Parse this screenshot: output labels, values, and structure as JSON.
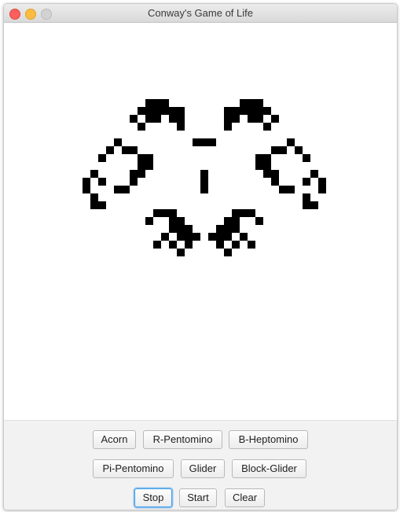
{
  "window": {
    "title": "Conway's Game of Life"
  },
  "grid": {
    "live_color": "#000000",
    "background_color": "#ffffff",
    "live_cells": [
      [
        185,
        126
      ],
      [
        195,
        126
      ],
      [
        205,
        126
      ],
      [
        305,
        126
      ],
      [
        315,
        126
      ],
      [
        325,
        126
      ],
      [
        175,
        136
      ],
      [
        185,
        136
      ],
      [
        195,
        136
      ],
      [
        205,
        136
      ],
      [
        215,
        136
      ],
      [
        225,
        136
      ],
      [
        285,
        136
      ],
      [
        295,
        136
      ],
      [
        305,
        136
      ],
      [
        315,
        136
      ],
      [
        325,
        136
      ],
      [
        335,
        136
      ],
      [
        165,
        146
      ],
      [
        185,
        146
      ],
      [
        195,
        146
      ],
      [
        215,
        146
      ],
      [
        225,
        146
      ],
      [
        285,
        146
      ],
      [
        295,
        146
      ],
      [
        315,
        146
      ],
      [
        325,
        146
      ],
      [
        345,
        146
      ],
      [
        175,
        156
      ],
      [
        225,
        156
      ],
      [
        285,
        156
      ],
      [
        335,
        156
      ],
      [
        245,
        176
      ],
      [
        255,
        176
      ],
      [
        265,
        176
      ],
      [
        145,
        176
      ],
      [
        365,
        176
      ],
      [
        135,
        186
      ],
      [
        155,
        186
      ],
      [
        165,
        186
      ],
      [
        345,
        186
      ],
      [
        355,
        186
      ],
      [
        375,
        186
      ],
      [
        125,
        196
      ],
      [
        175,
        196
      ],
      [
        185,
        196
      ],
      [
        325,
        196
      ],
      [
        335,
        196
      ],
      [
        385,
        196
      ],
      [
        175,
        206
      ],
      [
        185,
        206
      ],
      [
        325,
        206
      ],
      [
        335,
        206
      ],
      [
        115,
        216
      ],
      [
        165,
        216
      ],
      [
        175,
        216
      ],
      [
        255,
        216
      ],
      [
        335,
        216
      ],
      [
        345,
        216
      ],
      [
        395,
        216
      ],
      [
        105,
        226
      ],
      [
        125,
        226
      ],
      [
        165,
        226
      ],
      [
        255,
        226
      ],
      [
        345,
        226
      ],
      [
        385,
        226
      ],
      [
        405,
        226
      ],
      [
        105,
        236
      ],
      [
        145,
        236
      ],
      [
        155,
        236
      ],
      [
        255,
        236
      ],
      [
        355,
        236
      ],
      [
        365,
        236
      ],
      [
        405,
        236
      ],
      [
        115,
        246
      ],
      [
        385,
        246
      ],
      [
        115,
        256
      ],
      [
        125,
        256
      ],
      [
        385,
        256
      ],
      [
        395,
        256
      ],
      [
        195,
        266
      ],
      [
        205,
        266
      ],
      [
        215,
        266
      ],
      [
        295,
        266
      ],
      [
        305,
        266
      ],
      [
        315,
        266
      ],
      [
        185,
        276
      ],
      [
        215,
        276
      ],
      [
        225,
        276
      ],
      [
        285,
        276
      ],
      [
        295,
        276
      ],
      [
        325,
        276
      ],
      [
        215,
        286
      ],
      [
        225,
        286
      ],
      [
        235,
        286
      ],
      [
        275,
        286
      ],
      [
        285,
        286
      ],
      [
        295,
        286
      ],
      [
        205,
        296
      ],
      [
        225,
        296
      ],
      [
        235,
        296
      ],
      [
        245,
        296
      ],
      [
        265,
        296
      ],
      [
        275,
        296
      ],
      [
        285,
        296
      ],
      [
        305,
        296
      ],
      [
        195,
        306
      ],
      [
        215,
        306
      ],
      [
        235,
        306
      ],
      [
        275,
        306
      ],
      [
        295,
        306
      ],
      [
        315,
        306
      ],
      [
        225,
        316
      ],
      [
        285,
        316
      ]
    ]
  },
  "controls": {
    "row1": [
      "Acorn",
      "R-Pentomino",
      "B-Heptomino"
    ],
    "row2": [
      "Pi-Pentomino",
      "Glider",
      "Block-Glider"
    ],
    "row3": [
      "Stop",
      "Start",
      "Clear"
    ],
    "focused_button": "Stop",
    "focus_color": "#3d9be9"
  }
}
